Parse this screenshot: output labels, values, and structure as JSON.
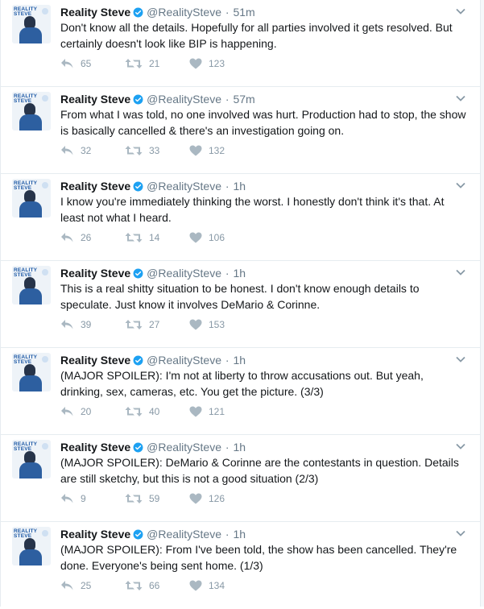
{
  "tweets": [
    {
      "name": "Reality Steve",
      "handle": "@RealitySteve",
      "time": "51m",
      "text": "Don't know all the details. Hopefully for all parties involved it gets resolved. But certainly doesn't look like BIP is happening.",
      "replies": "65",
      "retweets": "21",
      "likes": "123"
    },
    {
      "name": "Reality Steve",
      "handle": "@RealitySteve",
      "time": "57m",
      "text": "From what I was told, no one involved was hurt. Production had to stop, the show is basically cancelled & there's an investigation going on.",
      "replies": "32",
      "retweets": "33",
      "likes": "132"
    },
    {
      "name": "Reality Steve",
      "handle": "@RealitySteve",
      "time": "1h",
      "text": "I know you're immediately thinking the worst. I honestly don't think it's that. At least not what I heard.",
      "replies": "26",
      "retweets": "14",
      "likes": "106"
    },
    {
      "name": "Reality Steve",
      "handle": "@RealitySteve",
      "time": "1h",
      "text": "This is a real shitty situation to be honest. I don't know enough details to speculate. Just know it involves DeMario & Corinne.",
      "replies": "39",
      "retweets": "27",
      "likes": "153"
    },
    {
      "name": "Reality Steve",
      "handle": "@RealitySteve",
      "time": "1h",
      "text": "(MAJOR SPOILER): I'm not at liberty to throw accusations out. But yeah, drinking, sex, cameras, etc. You get the picture. (3/3)",
      "replies": "20",
      "retweets": "40",
      "likes": "121"
    },
    {
      "name": "Reality Steve",
      "handle": "@RealitySteve",
      "time": "1h",
      "text": "(MAJOR SPOILER): DeMario & Corinne are the contestants in question. Details are still sketchy, but this is not a good situation (2/3)",
      "replies": "9",
      "retweets": "59",
      "likes": "126"
    },
    {
      "name": "Reality Steve",
      "handle": "@RealitySteve",
      "time": "1h",
      "text": "(MAJOR SPOILER): From I've been told, the show has been cancelled. They're done. Everyone's being sent home. (1/3)",
      "replies": "25",
      "retweets": "66",
      "likes": "134"
    }
  ],
  "avatar_text": "REALITY STEVE",
  "separator": "·",
  "colors": {
    "verified": "#1da1f2",
    "muted": "#8899a6",
    "text": "#14171a",
    "border": "#e6ecf0"
  }
}
